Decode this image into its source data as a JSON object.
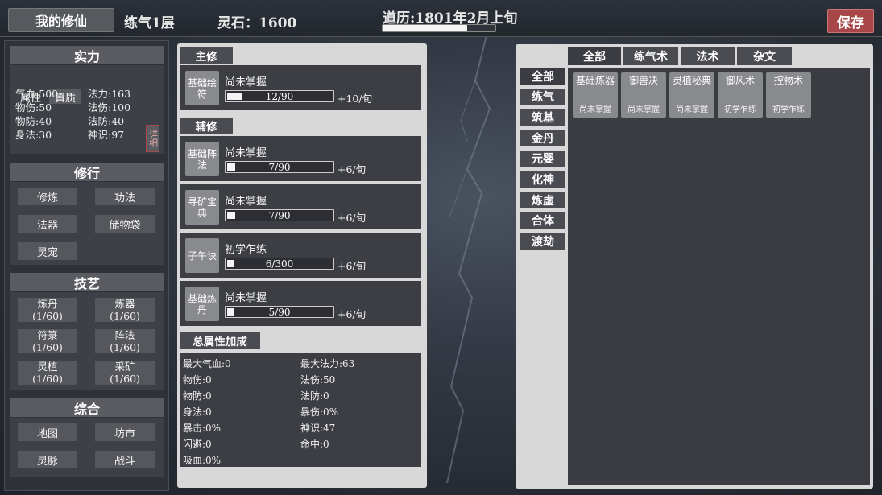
{
  "header": {
    "title": "我的修仙",
    "realm": "练气1层",
    "stone_label": "灵石：",
    "stone_value": "1600",
    "calendar": "道历:1801年2月上旬",
    "calendar_progress": 0.75,
    "save_label": "保存"
  },
  "left": {
    "strength": {
      "heading": "实力",
      "tab_attr": "属性",
      "tab_aptitude": "資质",
      "stats": [
        {
          "label": "气血:500"
        },
        {
          "label": "法力:163"
        },
        {
          "label": "物伤:50"
        },
        {
          "label": "法伤:100"
        },
        {
          "label": "物防:40"
        },
        {
          "label": "法防:40"
        },
        {
          "label": "身法:30"
        },
        {
          "label": "神识:97"
        }
      ],
      "detail_label": "详细"
    },
    "cultivation": {
      "heading": "修行",
      "buttons": [
        "修炼",
        "功法",
        "法器",
        "储物袋",
        "灵宠"
      ]
    },
    "arts": {
      "heading": "技艺",
      "buttons": [
        {
          "name": "炼丹",
          "level": "(1/60)"
        },
        {
          "name": "炼器",
          "level": "(1/60)"
        },
        {
          "name": "符箓",
          "level": "(1/60)"
        },
        {
          "name": "阵法",
          "level": "(1/60)"
        },
        {
          "name": "灵植",
          "level": "(1/60)"
        },
        {
          "name": "采矿",
          "level": "(1/60)"
        }
      ]
    },
    "general": {
      "heading": "综合",
      "buttons": [
        "地图",
        "坊市",
        "灵脉",
        "战斗"
      ]
    }
  },
  "middle": {
    "main_label": "主修",
    "aux_label": "辅修",
    "main_skill": {
      "icon": "基础绘符",
      "status": "尚未掌握",
      "progress": "12/90",
      "fraction": 0.133,
      "rate": "+10/旬"
    },
    "aux_skills": [
      {
        "icon": "基础阵法",
        "status": "尚未掌握",
        "progress": "7/90",
        "fraction": 0.078,
        "rate": "+6/旬"
      },
      {
        "icon": "寻矿宝典",
        "status": "尚未掌握",
        "progress": "7/90",
        "fraction": 0.078,
        "rate": "+6/旬"
      },
      {
        "icon": "子午诀",
        "status": "初学乍练",
        "progress": "6/300",
        "fraction": 0.02,
        "rate": "+6/旬"
      },
      {
        "icon": "基础炼丹",
        "status": "尚未掌握",
        "progress": "5/90",
        "fraction": 0.056,
        "rate": "+6/旬"
      }
    ],
    "totals_label": "总属性加成",
    "totals": [
      "最大气血:0",
      "最大法力:63",
      "物伤:0",
      "法伤:50",
      "物防:0",
      "法防:0",
      "身法:0",
      "暴伤:0%",
      "暴击:0%",
      "神识:47",
      "闪避:0",
      "命中:0",
      "吸血:0%"
    ]
  },
  "right": {
    "tabs": [
      "全部",
      "练气术",
      "法术",
      "杂文"
    ],
    "categories": [
      "全部",
      "练气",
      "筑基",
      "金丹",
      "元婴",
      "化神",
      "炼虚",
      "合体",
      "渡劫"
    ],
    "items": [
      {
        "name": "基础炼器",
        "status": "尚未掌握"
      },
      {
        "name": "御兽决",
        "status": "尚未掌握"
      },
      {
        "name": "灵植秘典",
        "status": "尚未掌握"
      },
      {
        "name": "御风术",
        "status": "初学乍练"
      },
      {
        "name": "控物术",
        "status": "初学乍练"
      }
    ]
  }
}
